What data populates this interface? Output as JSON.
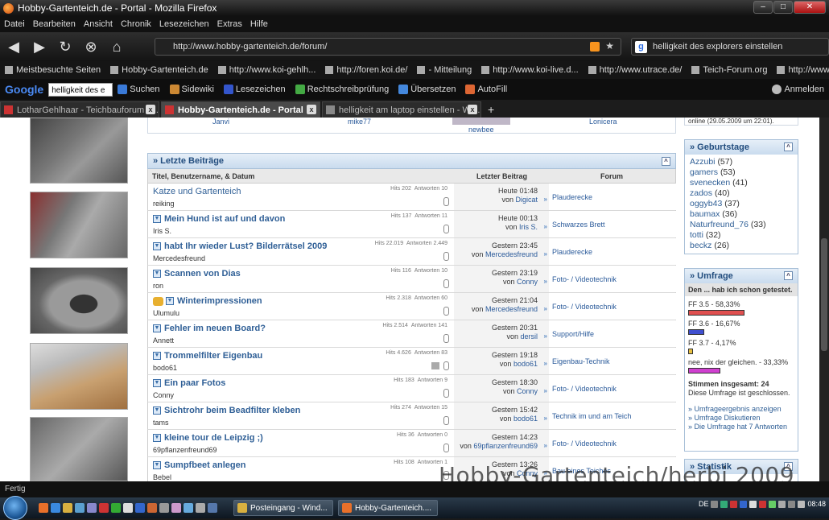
{
  "window": {
    "title": "Hobby-Gartenteich.de - Portal - Mozilla Firefox"
  },
  "menu": [
    "Datei",
    "Bearbeiten",
    "Ansicht",
    "Chronik",
    "Lesezeichen",
    "Extras",
    "Hilfe"
  ],
  "nav": {
    "url": "http://www.hobby-gartenteich.de/forum/",
    "search": "helligkeit des explorers einstellen"
  },
  "bookmarks": [
    "Meistbesuchte Seiten",
    "Hobby-Gartenteich.de",
    "http://www.koi-gehlh...",
    "http://foren.koi.de/",
    "- Mitteilung",
    "http://www.koi-live.d...",
    "http://www.utrace.de/",
    "Teich-Forum.org",
    "http://www.orienttanz..."
  ],
  "gtoolbar": {
    "search_value": "helligkeit des e",
    "items": [
      "Suchen",
      "Sidewiki",
      "Lesezeichen",
      "Rechtschreibprüfung",
      "Übersetzen",
      "AutoFill",
      "Anmelden"
    ]
  },
  "tabs": [
    {
      "label": "LotharGehlhaar - Teichbauforum :: l...",
      "color": "#c33"
    },
    {
      "label": "Hobby-Gartenteich.de - Portal",
      "color": "#c33"
    },
    {
      "label": "helligkeit am laptop einstellen - Win...",
      "color": "#888"
    }
  ],
  "topstrip": {
    "n1": "Janvi",
    "n2": "mike77",
    "n3": "newbee",
    "n4": "Lonicera"
  },
  "latest": {
    "title": "» Letzte Beiträge",
    "col_title": "Titel, Benutzername, & Datum",
    "col_last": "Letzter Beitrag",
    "col_forum": "Forum",
    "rows": [
      {
        "title": "Katze und Gartenteich",
        "author": "reiking",
        "hits": "Hits 202",
        "answers": "Antworten 10",
        "date": "Heute 01:48",
        "by": "Digicat",
        "forum": "Plauderecke",
        "plain": true,
        "newicon": false
      },
      {
        "title": "Mein Hund ist auf und davon",
        "author": "Iris S.",
        "hits": "Hits 137",
        "answers": "Antworten 11",
        "date": "Heute 00:13",
        "by": "Iris S.",
        "forum": "Schwarzes Brett",
        "plain": false,
        "newicon": true
      },
      {
        "title": "habt Ihr wieder Lust? Bilderrätsel 2009",
        "author": "Mercedesfreund",
        "hits": "Hits 22.019",
        "answers": "Antworten 2.449",
        "date": "Gestern 23:45",
        "by": "Mercedesfreund",
        "forum": "Plauderecke",
        "plain": false,
        "newicon": true
      },
      {
        "title": "Scannen von Dias",
        "author": "ron",
        "hits": "Hits 116",
        "answers": "Antworten 10",
        "date": "Gestern 23:19",
        "by": "Conny",
        "forum": "Foto- / Videotechnik",
        "plain": false,
        "newicon": true
      },
      {
        "title": "Winterimpressionen",
        "author": "Ulumulu",
        "hits": "Hits 2.318",
        "answers": "Antworten 60",
        "date": "Gestern 21:04",
        "by": "Mercedesfreund",
        "forum": "Foto- / Videotechnik",
        "plain": false,
        "newicon": true,
        "thumb": true
      },
      {
        "title": "Fehler im neuen Board?",
        "author": "Annett",
        "hits": "Hits 2.514",
        "answers": "Antworten 141",
        "date": "Gestern 20:31",
        "by": "dersil",
        "forum": "Support/Hilfe",
        "plain": false,
        "newicon": true
      },
      {
        "title": "Trommelfilter Eigenbau",
        "author": "bodo61",
        "hits": "Hits 4.626",
        "answers": "Antworten 83",
        "date": "Gestern 19:18",
        "by": "bodo61",
        "forum": "Eigenbau-Technik",
        "plain": false,
        "newicon": true,
        "pic": true
      },
      {
        "title": "Ein paar Fotos",
        "author": "Conny",
        "hits": "Hits 183",
        "answers": "Antworten 9",
        "date": "Gestern 18:30",
        "by": "Conny",
        "forum": "Foto- / Videotechnik",
        "plain": false,
        "newicon": true
      },
      {
        "title": "Sichtrohr beim Beadfilter kleben",
        "author": "tams",
        "hits": "Hits 274",
        "answers": "Antworten 15",
        "date": "Gestern 15:42",
        "by": "bodo61",
        "forum": "Technik im und am Teich",
        "plain": false,
        "newicon": true
      },
      {
        "title": "kleine tour de Leipzig ;)",
        "author": "69pflanzenfreund69",
        "hits": "Hits 36",
        "answers": "Antworten 0",
        "date": "Gestern 14:23",
        "by": "69pflanzenfreund69",
        "forum": "Foto- / Videotechnik",
        "plain": false,
        "newicon": true
      },
      {
        "title": "Sumpfbeet anlegen",
        "author": "Bebel",
        "hits": "Hits 108",
        "answers": "Antworten 1",
        "date": "Gestern 13:26",
        "by": "Conny",
        "forum": "Bau eines Teiches",
        "plain": false,
        "newicon": true
      }
    ],
    "von": "von"
  },
  "sidebar": {
    "online": "online (29.05.2009 um 22:01).",
    "birthdays_title": "» Geburtstage",
    "birthdays": [
      {
        "name": "Azzubi",
        "age": "(57)"
      },
      {
        "name": "gamers",
        "age": "(53)"
      },
      {
        "name": "svenecken",
        "age": "(41)"
      },
      {
        "name": "zados",
        "age": "(40)"
      },
      {
        "name": "oggyb43",
        "age": "(37)"
      },
      {
        "name": "baumax",
        "age": "(36)"
      },
      {
        "name": "Naturfreund_76",
        "age": "(33)"
      },
      {
        "name": "totti",
        "age": "(32)"
      },
      {
        "name": "beckz",
        "age": "(26)"
      }
    ],
    "poll_title": "» Umfrage",
    "poll_question": "Den ... hab ich schon getestet.",
    "poll_options": [
      {
        "label": "FF 3.5 - 58,33%",
        "percent": 58.33,
        "color": "#e05050"
      },
      {
        "label": "FF 3.6 - 16,67%",
        "percent": 16.67,
        "color": "#4050d0"
      },
      {
        "label": "FF 3.7 - 4,17%",
        "percent": 4.17,
        "color": "#e8c040"
      },
      {
        "label": "nee, nix der gleichen. - 33,33%",
        "percent": 33.33,
        "color": "#d040d0"
      }
    ],
    "poll_total": "Stimmen insgesamt: 24",
    "poll_closed": "Diese Umfrage ist geschlossen.",
    "poll_links": [
      "» Umfrageergebnis anzeigen",
      "» Umfrage Diskutieren",
      "» Die Umfrage hat 7 Antworten"
    ],
    "stats_title": "» Statistik"
  },
  "watermark": "Hobby-Gartenteich/herbi 2009",
  "status": "Fertig",
  "taskbar": {
    "tasks": [
      "Posteingang - Wind...",
      "Hobby-Gartenteich...."
    ],
    "lang": "DE",
    "time": "08:48"
  }
}
